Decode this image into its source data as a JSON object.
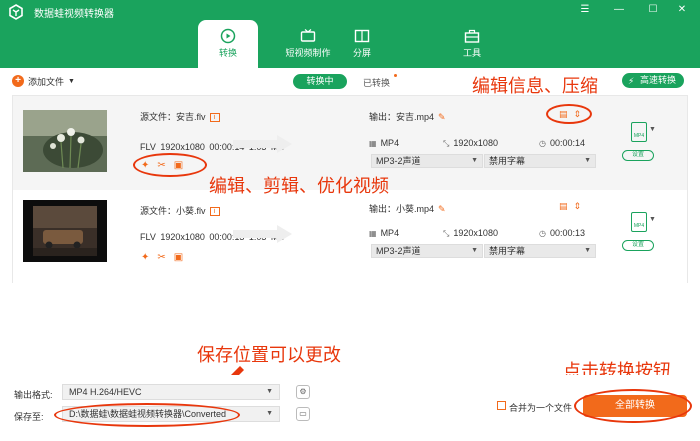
{
  "app": {
    "title": "数据蛙视频转换器"
  },
  "window_controls": [
    "☰",
    "—",
    "☐",
    "✕"
  ],
  "tabs": [
    {
      "label": "转换",
      "icon": "convert-icon",
      "active": true
    },
    {
      "label": "短视频制作",
      "icon": "tv-icon",
      "active": false
    },
    {
      "label": "分屏",
      "icon": "split-screen-icon",
      "active": false
    },
    {
      "label": "工具",
      "icon": "toolbox-icon",
      "active": false
    }
  ],
  "toolbar": {
    "add_file_label": "添加文件",
    "converting_label": "转换中",
    "converted_label": "已转换",
    "fast_convert_label": "高速转换"
  },
  "files": [
    {
      "source_label": "源文件：安吉.flv",
      "source_meta": "FLV  1920x1080  00:00:14  1.03 MB",
      "output_label": "输出：安吉.mp4",
      "format": "MP4",
      "resolution": "1920x1080",
      "duration": "00:00:14",
      "audio": "MP3-2声道",
      "subtitle": "禁用字幕",
      "settings_label": "设置",
      "format_icon_text": "MP4"
    },
    {
      "source_label": "源文件：小葵.flv",
      "source_meta": "FLV  1920x1080  00:00:13  1.03 MB",
      "output_label": "输出：小葵.mp4",
      "format": "MP4",
      "resolution": "1920x1080",
      "duration": "00:00:13",
      "audio": "MP3-2声道",
      "subtitle": "禁用字幕",
      "settings_label": "设置",
      "format_icon_text": "MP4"
    }
  ],
  "annotations": {
    "edit_compress": "编辑信息、压缩",
    "edit_trim_optimize": "编辑、剪辑、优化视频",
    "save_location": "保存位置可以更改",
    "click_convert": "点击转换按钮"
  },
  "bottom": {
    "output_format_label": "输出格式:",
    "output_format_value": "MP4 H.264/HEVC",
    "save_to_label": "保存至:",
    "save_to_value": "D:\\数据蛙\\数据蛙视频转换器\\Converted",
    "merge_label": "合并为一个文件",
    "convert_all_label": "全部转换"
  },
  "colors": {
    "brand_green": "#1aa35d",
    "accent_orange": "#f26a1b",
    "annotation_red": "#e8370c"
  }
}
